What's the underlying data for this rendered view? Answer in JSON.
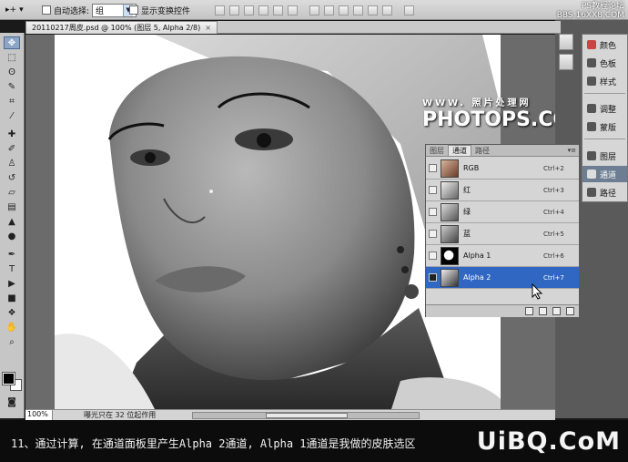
{
  "options_bar": {
    "move_tool": "▸+",
    "auto_select_label": "自动选择:",
    "auto_select_value": "组",
    "show_transform_label": "显示变换控件"
  },
  "site_tag": {
    "line1": "PS教程论坛",
    "line2": "BBS.16XX8.COM"
  },
  "document_tab": {
    "title": "20110217周皮.psd @ 100% (图层 5, Alpha 2/8)",
    "close": "×"
  },
  "dock": {
    "items": [
      "颜色",
      "色板",
      "样式",
      "调整",
      "蒙版",
      "图层",
      "通道",
      "路径"
    ],
    "selected": "通道"
  },
  "watermark": {
    "line1": "WWW. 照片处理网",
    "line2": "PHOTOPS.COM"
  },
  "channels_panel": {
    "tabs": [
      "图层",
      "通道",
      "路径"
    ],
    "active_tab": "通道",
    "menu_icon": "▾≡",
    "rows": [
      {
        "name": "RGB",
        "shortcut": "Ctrl+2",
        "thumb": "color"
      },
      {
        "name": "红",
        "shortcut": "Ctrl+3",
        "thumb": "gray"
      },
      {
        "name": "绿",
        "shortcut": "Ctrl+4",
        "thumb": "gray"
      },
      {
        "name": "蓝",
        "shortcut": "Ctrl+5",
        "thumb": "gray"
      },
      {
        "name": "Alpha 1",
        "shortcut": "Ctrl+6",
        "thumb": "mask"
      },
      {
        "name": "Alpha 2",
        "shortcut": "Ctrl+7",
        "thumb": "gray",
        "selected": true
      }
    ]
  },
  "status_bar": {
    "zoom": "100%",
    "message": "曝光只在 32 位起作用"
  },
  "caption": {
    "text": "11、通过计算, 在通道面板里产生Alpha 2通道, Alpha 1通道是我做的皮肤选区",
    "logo": "UiBQ.CoM"
  },
  "colors": {
    "selection_blue": "#2f67c2",
    "panel_gray": "#d5d5d5",
    "dock_selected": "#6d7d92"
  }
}
